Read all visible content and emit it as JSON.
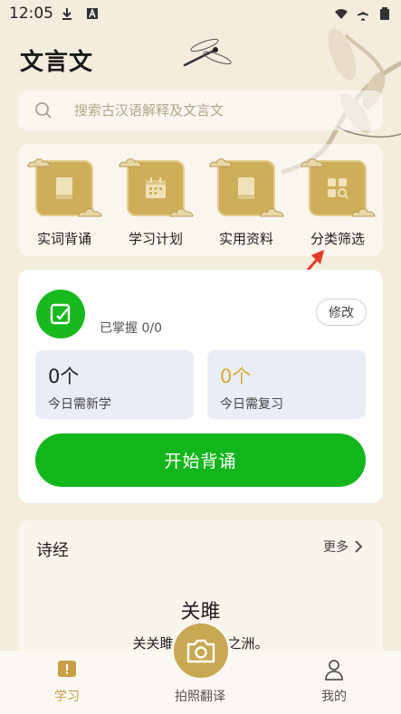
{
  "status_bar": {
    "time": "12:05"
  },
  "header": {
    "title": "文言文"
  },
  "search": {
    "placeholder": "搜索古汉语解释及文言文"
  },
  "categories": [
    {
      "label": "实词背诵",
      "icon": "book-icon"
    },
    {
      "label": "学习计划",
      "icon": "calendar-icon"
    },
    {
      "label": "实用资料",
      "icon": "book-icon"
    },
    {
      "label": "分类筛选",
      "icon": "grid-search-icon"
    }
  ],
  "study": {
    "mastered": "已掌握 0/0",
    "edit_label": "修改",
    "new_count": "0个",
    "new_label": "今日需新学",
    "review_count": "0个",
    "review_label": "今日需复习",
    "start_label": "开始背诵"
  },
  "poem": {
    "section": "诗经",
    "more": "更多",
    "title": "关雎",
    "line": "关关雎鸠，在河之洲。"
  },
  "tabs": [
    {
      "label": "学习",
      "active": true
    },
    {
      "label": "拍照翻译",
      "active": false
    },
    {
      "label": "我的",
      "active": false
    }
  ],
  "colors": {
    "accent_green": "#13b51d",
    "gold": "#c9a853",
    "background": "#f4ecdc",
    "arrow_red": "#e53a2c"
  }
}
